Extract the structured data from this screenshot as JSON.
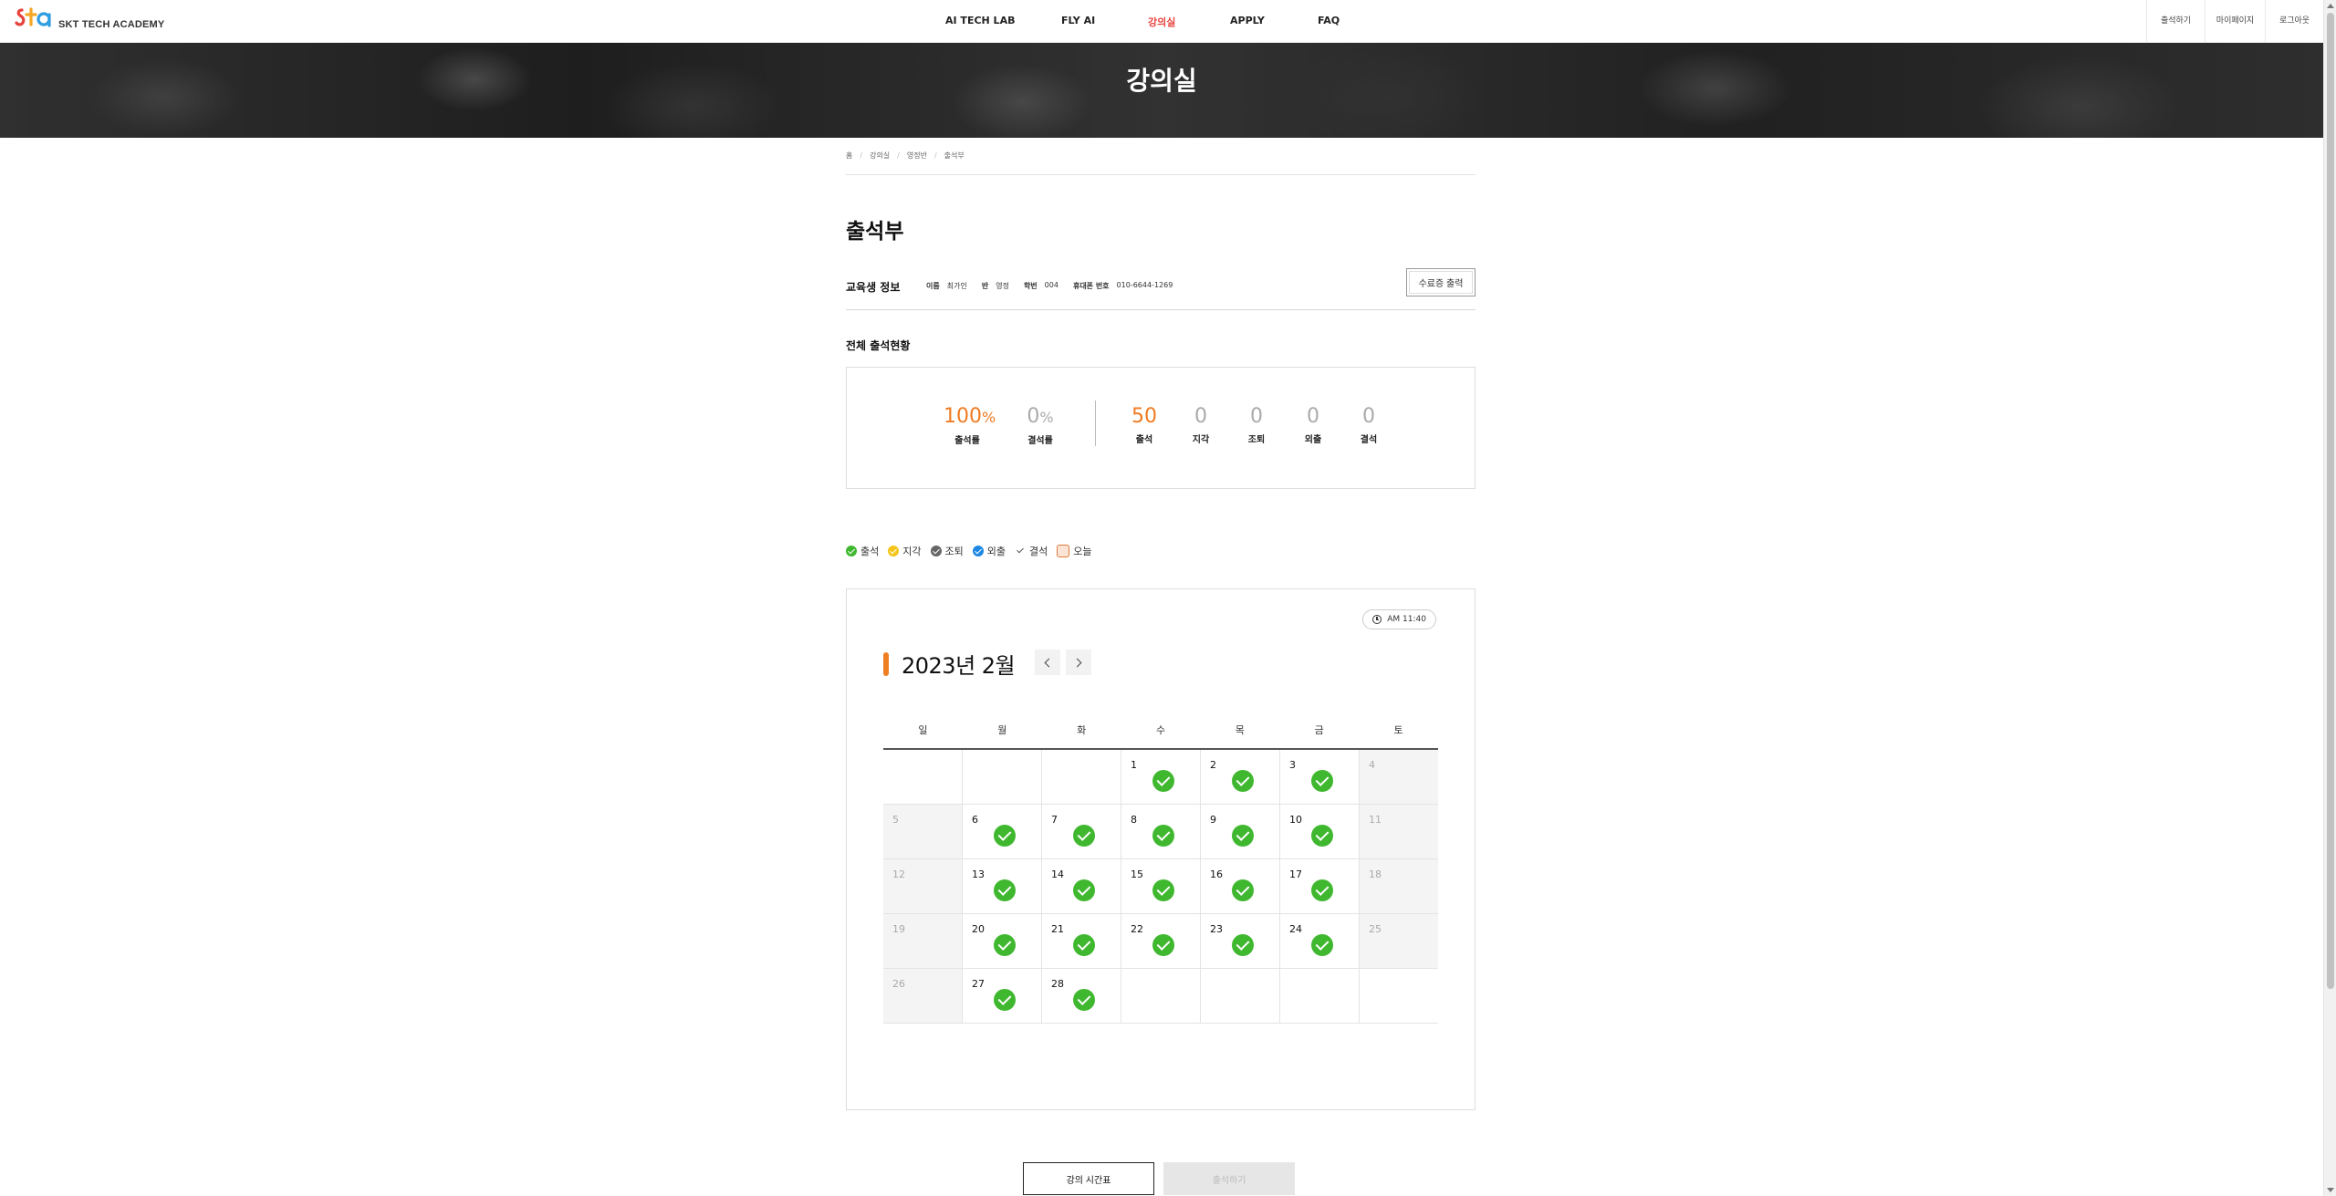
{
  "header": {
    "logo_text": "SKT TECH ACADEMY",
    "nav": [
      {
        "label": "AI TECH LAB",
        "active": false
      },
      {
        "label": "FLY AI",
        "active": false
      },
      {
        "label": "강의실",
        "active": true
      },
      {
        "label": "APPLY",
        "active": false
      },
      {
        "label": "FAQ",
        "active": false
      }
    ],
    "util": [
      "출석하기",
      "마이페이지",
      "로그아웃"
    ]
  },
  "hero": {
    "title": "강의실"
  },
  "breadcrumb": [
    "홈",
    "강의실",
    "영정반",
    "출석부"
  ],
  "page_title": "출석부",
  "student_info": {
    "label": "교육생 정보",
    "fields": [
      {
        "key": "이름",
        "value": "최가인"
      },
      {
        "key": "반",
        "value": "영정"
      },
      {
        "key": "학번",
        "value": "004"
      },
      {
        "key": "휴대폰 번호",
        "value": "010-6644-1269"
      }
    ],
    "cert_button": "수료증 출력"
  },
  "summary": {
    "title": "전체 출석현황",
    "rates": [
      {
        "value": "100",
        "unit": "%",
        "label": "출석률",
        "highlight": true
      },
      {
        "value": "0",
        "unit": "%",
        "label": "결석률",
        "highlight": false
      }
    ],
    "counts": [
      {
        "value": "50",
        "label": "출석",
        "highlight": true
      },
      {
        "value": "0",
        "label": "지각",
        "highlight": false
      },
      {
        "value": "0",
        "label": "조퇴",
        "highlight": false
      },
      {
        "value": "0",
        "label": "외출",
        "highlight": false
      },
      {
        "value": "0",
        "label": "결석",
        "highlight": false
      }
    ]
  },
  "legend": [
    {
      "label": "출석",
      "icon": "check-circle-icon",
      "color": "#3fb82f"
    },
    {
      "label": "지각",
      "icon": "check-circle-icon",
      "color": "#f5c518"
    },
    {
      "label": "조퇴",
      "icon": "check-circle-icon",
      "color": "#666666"
    },
    {
      "label": "외출",
      "icon": "check-circle-icon",
      "color": "#1e88e5"
    },
    {
      "label": "결석",
      "icon": "check-icon",
      "color": "#555555"
    },
    {
      "label": "오늘",
      "icon": "today-box-icon",
      "color": "#e07a3a"
    }
  ],
  "calendar": {
    "time": "AM 11:40",
    "month_label": "2023년 2월",
    "weekdays": [
      "일",
      "월",
      "화",
      "수",
      "목",
      "금",
      "토"
    ],
    "weeks": [
      [
        null,
        null,
        null,
        {
          "d": 1,
          "att": true
        },
        {
          "d": 2,
          "att": true
        },
        {
          "d": 3,
          "att": true
        },
        {
          "d": 4,
          "att": false
        }
      ],
      [
        {
          "d": 5,
          "att": false
        },
        {
          "d": 6,
          "att": true
        },
        {
          "d": 7,
          "att": true
        },
        {
          "d": 8,
          "att": true
        },
        {
          "d": 9,
          "att": true
        },
        {
          "d": 10,
          "att": true
        },
        {
          "d": 11,
          "att": false
        }
      ],
      [
        {
          "d": 12,
          "att": false
        },
        {
          "d": 13,
          "att": true
        },
        {
          "d": 14,
          "att": true
        },
        {
          "d": 15,
          "att": true
        },
        {
          "d": 16,
          "att": true
        },
        {
          "d": 17,
          "att": true
        },
        {
          "d": 18,
          "att": false
        }
      ],
      [
        {
          "d": 19,
          "att": false
        },
        {
          "d": 20,
          "att": true
        },
        {
          "d": 21,
          "att": true
        },
        {
          "d": 22,
          "att": true
        },
        {
          "d": 23,
          "att": true
        },
        {
          "d": 24,
          "att": true
        },
        {
          "d": 25,
          "att": false
        }
      ],
      [
        {
          "d": 26,
          "att": false
        },
        {
          "d": 27,
          "att": true
        },
        {
          "d": 28,
          "att": true
        },
        null,
        null,
        null,
        null
      ]
    ]
  },
  "buttons": {
    "schedule": "강의 시간표",
    "attend": "출석하기"
  },
  "colors": {
    "accent": "#ef7b22",
    "nav_active": "#e8423c",
    "present": "#3fb82f"
  }
}
